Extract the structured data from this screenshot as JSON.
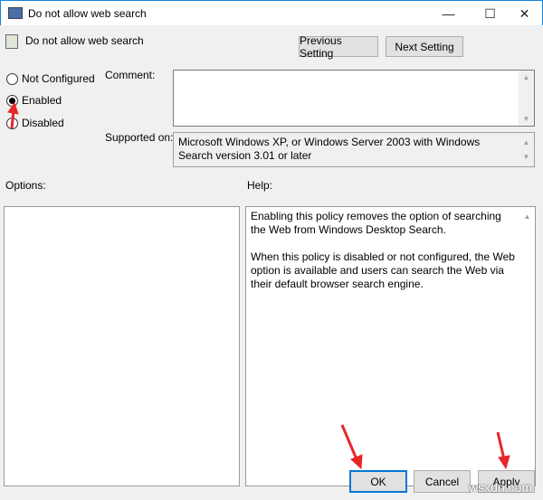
{
  "window": {
    "title": "Do not allow web search",
    "minimize": "—",
    "maximize": "☐",
    "close": "✕"
  },
  "header": {
    "policy_name": "Do not allow web search",
    "previous_label": "Previous Setting",
    "next_label": "Next Setting"
  },
  "state": {
    "options": [
      "Not Configured",
      "Enabled",
      "Disabled"
    ],
    "selected": "Enabled"
  },
  "comment": {
    "label": "Comment:",
    "value": ""
  },
  "supported": {
    "label": "Supported on:",
    "value": "Microsoft Windows XP, or Windows Server 2003 with Windows Search version 3.01 or later"
  },
  "options_label": "Options:",
  "help": {
    "label": "Help:",
    "paragraphs": [
      "Enabling this policy removes the option of searching the Web from Windows Desktop Search.",
      "When this policy is disabled or not configured, the Web option is available and users can search the Web via their default browser search engine."
    ]
  },
  "footer": {
    "ok": "OK",
    "cancel": "Cancel",
    "apply": "Apply"
  },
  "watermark": "wsxdn.com",
  "colors": {
    "accent": "#0078d7",
    "annotation_arrow": "#e8262a"
  }
}
